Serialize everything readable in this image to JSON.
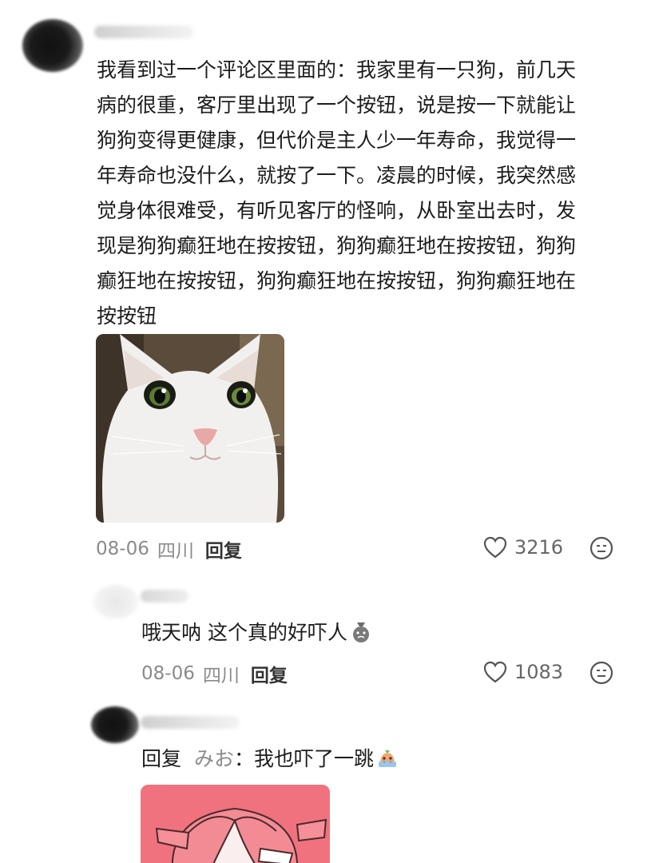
{
  "comment1": {
    "text_lines": [
      "我看到过一个评论区里面的：我家里有一只狗，前几天",
      "病的很重，客厅里出现了一个按钮，说是按一下就能让",
      "狗狗变得更健康，但代价是主人少一年寿命，我觉得一",
      "年寿命也没什么，就按了一下。凌晨的时候，我突然感",
      "觉身体很难受，有听见客厅的怪响，从卧室出去时，发",
      "现是狗狗癫狂地在按按钮，狗狗癫狂地在按按钮，狗狗",
      "癫狂地在按按钮，狗狗癫狂地在按按钮，狗狗癫狂地在",
      "按按钮"
    ],
    "date": "08-06",
    "location": "四川",
    "reply_label": "回复",
    "likes": "3216"
  },
  "reply1": {
    "text": "哦天呐 这个真的好吓人",
    "date": "08-06",
    "location": "四川",
    "reply_label": "回复",
    "likes": "1083"
  },
  "reply2": {
    "prefix": "回复",
    "mention": "みお",
    "colon": "：",
    "text": "我也吓了一跳"
  },
  "icons": {
    "like": "heart-outline-icon",
    "face": "neutral-face-icon"
  }
}
